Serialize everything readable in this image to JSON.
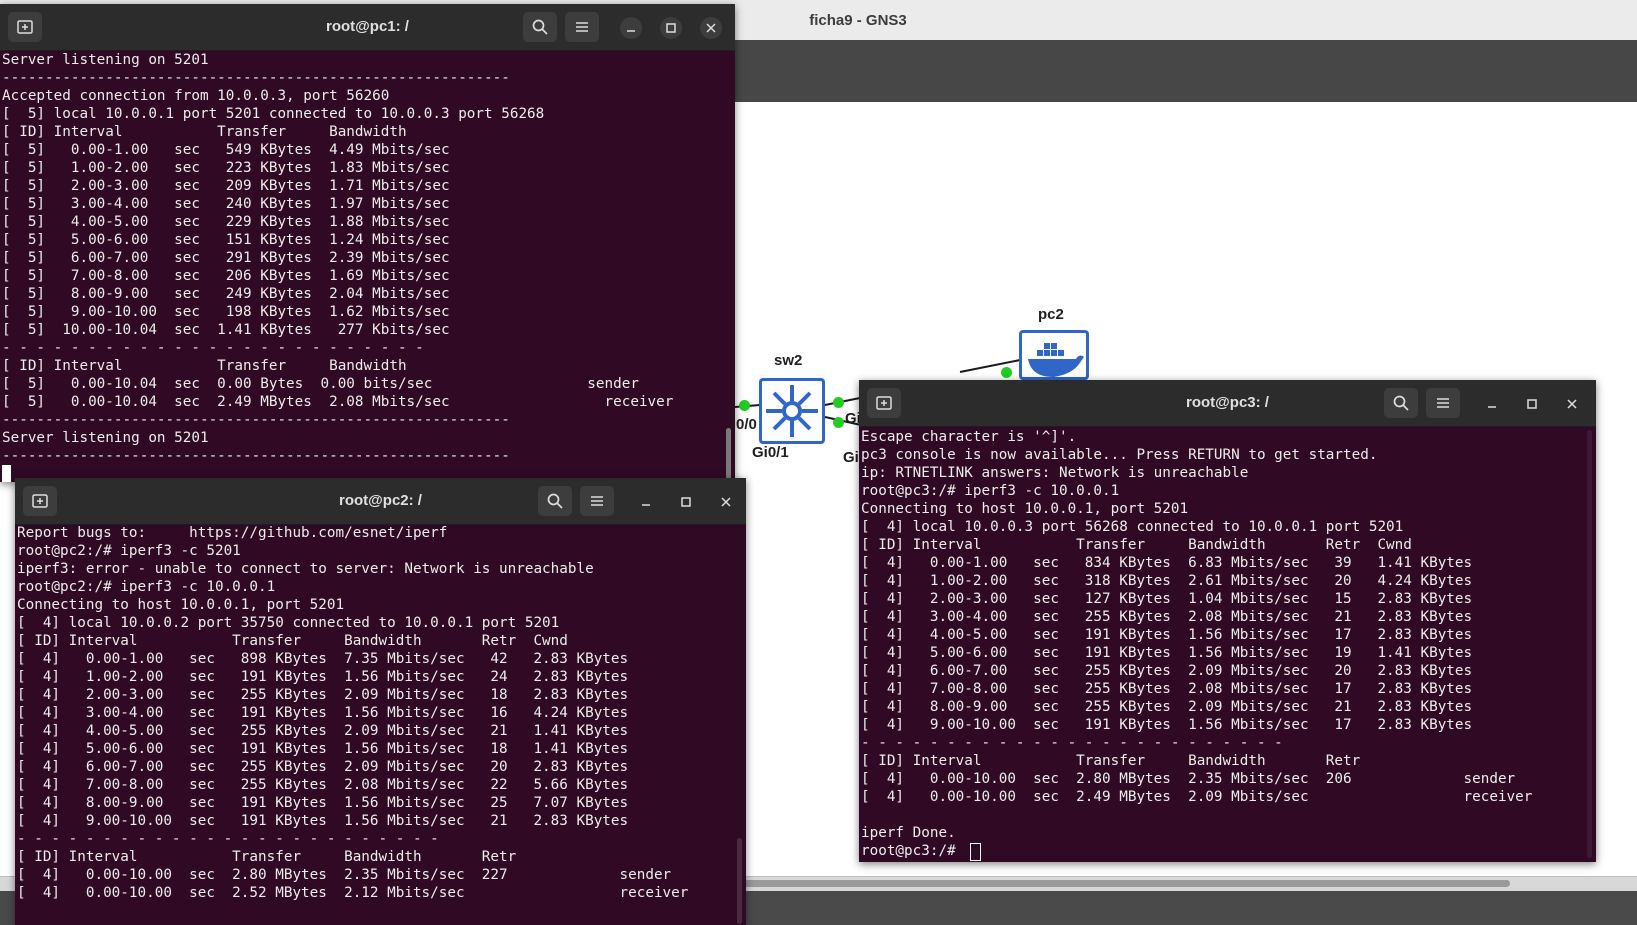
{
  "gns3": {
    "title": "ficha9 - GNS3",
    "nodes": {
      "sw2": "sw2",
      "pc2": "pc2"
    },
    "interfaces": {
      "sw2_left": "0/0",
      "sw2_bottom": "Gi0/1",
      "sw2_right1": "Gi",
      "sw2_right2": "Gi"
    },
    "link_color": "#1a1a1a",
    "status_color": "#22cc22"
  },
  "terminals": {
    "pc1": {
      "title": "root@pc1: /",
      "lines": [
        "Server listening on 5201",
        "-----------------------------------------------------------",
        "Accepted connection from 10.0.0.3, port 56260",
        "[  5] local 10.0.0.1 port 5201 connected to 10.0.0.3 port 56268",
        "[ ID] Interval           Transfer     Bandwidth",
        "[  5]   0.00-1.00   sec   549 KBytes  4.49 Mbits/sec",
        "[  5]   1.00-2.00   sec   223 KBytes  1.83 Mbits/sec",
        "[  5]   2.00-3.00   sec   209 KBytes  1.71 Mbits/sec",
        "[  5]   3.00-4.00   sec   240 KBytes  1.97 Mbits/sec",
        "[  5]   4.00-5.00   sec   229 KBytes  1.88 Mbits/sec",
        "[  5]   5.00-6.00   sec   151 KBytes  1.24 Mbits/sec",
        "[  5]   6.00-7.00   sec   291 KBytes  2.39 Mbits/sec",
        "[  5]   7.00-8.00   sec   206 KBytes  1.69 Mbits/sec",
        "[  5]   8.00-9.00   sec   249 KBytes  2.04 Mbits/sec",
        "[  5]   9.00-10.00  sec   198 KBytes  1.62 Mbits/sec",
        "[  5]  10.00-10.04  sec  1.41 KBytes   277 Kbits/sec",
        "- - - - - - - - - - - - - - - - - - - - - - - - -",
        "[ ID] Interval           Transfer     Bandwidth",
        "[  5]   0.00-10.04  sec  0.00 Bytes  0.00 bits/sec                  sender",
        "[  5]   0.00-10.04  sec  2.49 MBytes  2.08 Mbits/sec                  receiver",
        "-----------------------------------------------------------",
        "Server listening on 5201",
        "-----------------------------------------------------------"
      ]
    },
    "pc2": {
      "title": "root@pc2: /",
      "lines": [
        "Report bugs to:     https://github.com/esnet/iperf",
        "root@pc2:/# iperf3 -c 5201",
        "iperf3: error - unable to connect to server: Network is unreachable",
        "root@pc2:/# iperf3 -c 10.0.0.1",
        "Connecting to host 10.0.0.1, port 5201",
        "[  4] local 10.0.0.2 port 35750 connected to 10.0.0.1 port 5201",
        "[ ID] Interval           Transfer     Bandwidth       Retr  Cwnd",
        "[  4]   0.00-1.00   sec   898 KBytes  7.35 Mbits/sec   42   2.83 KBytes",
        "[  4]   1.00-2.00   sec   191 KBytes  1.56 Mbits/sec   24   2.83 KBytes",
        "[  4]   2.00-3.00   sec   255 KBytes  2.09 Mbits/sec   18   2.83 KBytes",
        "[  4]   3.00-4.00   sec   191 KBytes  1.56 Mbits/sec   16   4.24 KBytes",
        "[  4]   4.00-5.00   sec   255 KBytes  2.09 Mbits/sec   21   1.41 KBytes",
        "[  4]   5.00-6.00   sec   191 KBytes  1.56 Mbits/sec   18   1.41 KBytes",
        "[  4]   6.00-7.00   sec   255 KBytes  2.09 Mbits/sec   20   2.83 KBytes",
        "[  4]   7.00-8.00   sec   255 KBytes  2.08 Mbits/sec   22   5.66 KBytes",
        "[  4]   8.00-9.00   sec   191 KBytes  1.56 Mbits/sec   25   7.07 KBytes",
        "[  4]   9.00-10.00  sec   191 KBytes  1.56 Mbits/sec   21   2.83 KBytes",
        "- - - - - - - - - - - - - - - - - - - - - - - - -",
        "[ ID] Interval           Transfer     Bandwidth       Retr",
        "[  4]   0.00-10.00  sec  2.80 MBytes  2.35 Mbits/sec  227             sender",
        "[  4]   0.00-10.00  sec  2.52 MBytes  2.12 Mbits/sec                  receiver"
      ]
    },
    "pc3": {
      "title": "root@pc3: /",
      "lines": [
        "Escape character is '^]'.",
        "pc3 console is now available... Press RETURN to get started.",
        "ip: RTNETLINK answers: Network is unreachable",
        "root@pc3:/# iperf3 -c 10.0.0.1",
        "Connecting to host 10.0.0.1, port 5201",
        "[  4] local 10.0.0.3 port 56268 connected to 10.0.0.1 port 5201",
        "[ ID] Interval           Transfer     Bandwidth       Retr  Cwnd",
        "[  4]   0.00-1.00   sec   834 KBytes  6.83 Mbits/sec   39   1.41 KBytes",
        "[  4]   1.00-2.00   sec   318 KBytes  2.61 Mbits/sec   20   4.24 KBytes",
        "[  4]   2.00-3.00   sec   127 KBytes  1.04 Mbits/sec   15   2.83 KBytes",
        "[  4]   3.00-4.00   sec   255 KBytes  2.08 Mbits/sec   21   2.83 KBytes",
        "[  4]   4.00-5.00   sec   191 KBytes  1.56 Mbits/sec   17   2.83 KBytes",
        "[  4]   5.00-6.00   sec   191 KBytes  1.56 Mbits/sec   19   1.41 KBytes",
        "[  4]   6.00-7.00   sec   255 KBytes  2.09 Mbits/sec   20   2.83 KBytes",
        "[  4]   7.00-8.00   sec   255 KBytes  2.08 Mbits/sec   17   2.83 KBytes",
        "[  4]   8.00-9.00   sec   255 KBytes  2.09 Mbits/sec   21   2.83 KBytes",
        "[  4]   9.00-10.00  sec   191 KBytes  1.56 Mbits/sec   17   2.83 KBytes",
        "- - - - - - - - - - - - - - - - - - - - - - - - -",
        "[ ID] Interval           Transfer     Bandwidth       Retr",
        "[  4]   0.00-10.00  sec  2.80 MBytes  2.35 Mbits/sec  206             sender",
        "[  4]   0.00-10.00  sec  2.49 MBytes  2.09 Mbits/sec                  receiver",
        "",
        "iperf Done.",
        "root@pc3:/# "
      ]
    }
  },
  "colors": {
    "terminal_bg": "#300a24",
    "terminal_fg": "#ececec",
    "titlebar_bg": "#2c2c2c",
    "node_border": "#2f66c7"
  }
}
